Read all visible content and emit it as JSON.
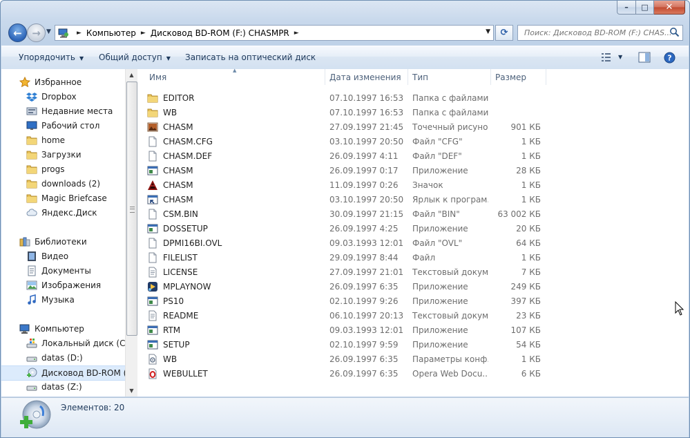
{
  "window": {
    "caption_buttons": {
      "minimize": "–",
      "maximize": "□",
      "close": "✕"
    }
  },
  "nav": {
    "back_glyph": "←",
    "forward_glyph": "→",
    "breadcrumb": [
      "Компьютер",
      "Дисковод BD-ROM (F:) CHASMPR"
    ],
    "refresh_glyph": "⟳",
    "search_placeholder": "Поиск: Дисковод BD-ROM (F:) CHAS..."
  },
  "toolbar": {
    "organize": "Упорядочить",
    "share": "Общий доступ",
    "burn": "Записать на оптический диск"
  },
  "sidebar": {
    "groups": [
      {
        "label": "Избранное",
        "icon": "star-icon",
        "items": [
          {
            "label": "Dropbox",
            "icon": "dropbox-icon"
          },
          {
            "label": "Недавние места",
            "icon": "recent-places-icon"
          },
          {
            "label": "Рабочий стол",
            "icon": "desktop-icon"
          },
          {
            "label": "home",
            "icon": "folder-icon"
          },
          {
            "label": "Загрузки",
            "icon": "folder-icon"
          },
          {
            "label": "progs",
            "icon": "folder-icon"
          },
          {
            "label": "downloads (2)",
            "icon": "folder-icon"
          },
          {
            "label": "Magic Briefcase",
            "icon": "folder-icon"
          },
          {
            "label": "Яндекс.Диск",
            "icon": "cloud-icon"
          }
        ]
      },
      {
        "label": "Библиотеки",
        "icon": "libraries-icon",
        "items": [
          {
            "label": "Видео",
            "icon": "video-icon"
          },
          {
            "label": "Документы",
            "icon": "documents-icon"
          },
          {
            "label": "Изображения",
            "icon": "pictures-icon"
          },
          {
            "label": "Музыка",
            "icon": "music-icon"
          }
        ]
      },
      {
        "label": "Компьютер",
        "icon": "computer-icon",
        "items": [
          {
            "label": "Локальный диск (C:)",
            "icon": "windows-drive-icon"
          },
          {
            "label": "datas (D:)",
            "icon": "drive-icon"
          },
          {
            "label": "Дисковод BD-ROM (F:",
            "icon": "bd-rom-icon",
            "selected": true
          },
          {
            "label": "datas (Z:)",
            "icon": "drive-icon"
          }
        ]
      }
    ]
  },
  "columns": {
    "name": "Имя",
    "date": "Дата изменения",
    "type": "Тип",
    "size": "Размер"
  },
  "files": [
    {
      "name": "EDITOR",
      "date": "07.10.1997 16:53",
      "type": "Папка с файлами",
      "size": "",
      "icon": "folder-icon"
    },
    {
      "name": "WB",
      "date": "07.10.1997 16:53",
      "type": "Папка с файлами",
      "size": "",
      "icon": "folder-icon"
    },
    {
      "name": "CHASM",
      "date": "27.09.1997 21:45",
      "type": "Точечный рисунок",
      "size": "901 КБ",
      "icon": "bitmap-icon"
    },
    {
      "name": "CHASM.CFG",
      "date": "03.10.1997 20:50",
      "type": "Файл \"CFG\"",
      "size": "1 КБ",
      "icon": "file-icon"
    },
    {
      "name": "CHASM.DEF",
      "date": "26.09.1997 4:11",
      "type": "Файл \"DEF\"",
      "size": "1 КБ",
      "icon": "file-icon"
    },
    {
      "name": "CHASM",
      "date": "26.09.1997 0:17",
      "type": "Приложение",
      "size": "28 КБ",
      "icon": "app-icon"
    },
    {
      "name": "CHASM",
      "date": "11.09.1997 0:26",
      "type": "Значок",
      "size": "1 КБ",
      "icon": "chasm-logo-icon"
    },
    {
      "name": "CHASM",
      "date": "03.10.1997 20:50",
      "type": "Ярлык к програм...",
      "size": "1 КБ",
      "icon": "shortcut-icon"
    },
    {
      "name": "CSM.BIN",
      "date": "30.09.1997 21:15",
      "type": "Файл \"BIN\"",
      "size": "63 002 КБ",
      "icon": "file-icon"
    },
    {
      "name": "DOSSETUP",
      "date": "26.09.1997 4:25",
      "type": "Приложение",
      "size": "20 КБ",
      "icon": "app-icon"
    },
    {
      "name": "DPMI16BI.OVL",
      "date": "09.03.1993 12:01",
      "type": "Файл \"OVL\"",
      "size": "64 КБ",
      "icon": "file-icon"
    },
    {
      "name": "FILELIST",
      "date": "29.09.1997 8:44",
      "type": "Файл",
      "size": "1 КБ",
      "icon": "file-icon"
    },
    {
      "name": "LICENSE",
      "date": "27.09.1997 21:01",
      "type": "Текстовый докум...",
      "size": "7 КБ",
      "icon": "text-icon"
    },
    {
      "name": "MPLAYNOW",
      "date": "26.09.1997 6:35",
      "type": "Приложение",
      "size": "249 КБ",
      "icon": "mplayer-icon"
    },
    {
      "name": "PS10",
      "date": "02.10.1997 9:26",
      "type": "Приложение",
      "size": "397 КБ",
      "icon": "app-icon"
    },
    {
      "name": "README",
      "date": "06.10.1997 20:13",
      "type": "Текстовый докум...",
      "size": "23 КБ",
      "icon": "text-icon"
    },
    {
      "name": "RTM",
      "date": "09.03.1993 12:01",
      "type": "Приложение",
      "size": "107 КБ",
      "icon": "app-icon"
    },
    {
      "name": "SETUP",
      "date": "02.10.1997 9:59",
      "type": "Приложение",
      "size": "54 КБ",
      "icon": "app-icon"
    },
    {
      "name": "WB",
      "date": "26.09.1997 6:35",
      "type": "Параметры конф...",
      "size": "1 КБ",
      "icon": "settings-file-icon"
    },
    {
      "name": "WEBULLET",
      "date": "26.09.1997 6:35",
      "type": "Opera Web Docu...",
      "size": "6 КБ",
      "icon": "opera-icon"
    }
  ],
  "status": {
    "count_text": "Элементов: 20"
  }
}
